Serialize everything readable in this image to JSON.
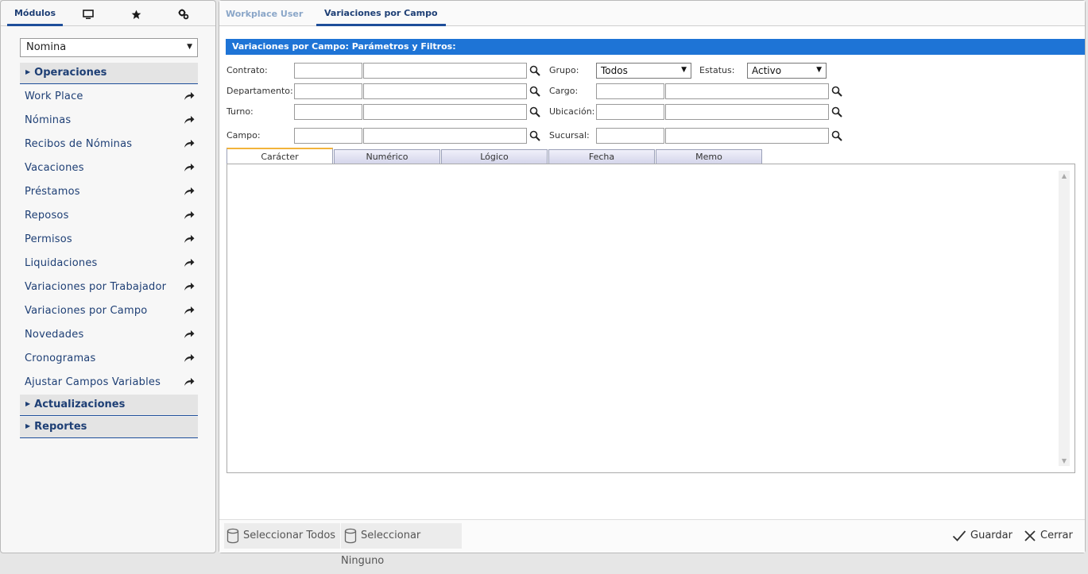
{
  "left_panel": {
    "tabs": {
      "modules": "Módulos"
    },
    "module_select": {
      "value": "Nomina"
    },
    "sections": {
      "operaciones": "Operaciones",
      "actualizaciones": "Actualizaciones",
      "reportes": "Reportes"
    },
    "items": [
      "Work Place",
      "Nóminas",
      "Recibos de Nóminas",
      "Vacaciones",
      "Préstamos",
      "Reposos",
      "Permisos",
      "Liquidaciones",
      "Variaciones por Trabajador",
      "Variaciones por Campo",
      "Novedades",
      "Cronogramas",
      "Ajustar Campos Variables"
    ]
  },
  "main_tabs": {
    "workplace": "Workplace User",
    "active": "Variaciones por Campo"
  },
  "filter_bar": {
    "title": "Variaciones por Campo: Parámetros y Filtros:"
  },
  "filters": {
    "contrato": "Contrato:",
    "departamento": "Departamento:",
    "turno": "Turno:",
    "campo": "Campo:",
    "grupo": "Grupo:",
    "grupo_value": "Todos",
    "estatus": "Estatus:",
    "estatus_value": "Activo",
    "cargo": "Cargo:",
    "ubicacion": "Ubicación:",
    "sucursal": "Sucursal:"
  },
  "sub_tabs": [
    "Carácter",
    "Numérico",
    "Lógico",
    "Fecha",
    "Memo"
  ],
  "footer": {
    "select_all": "Seleccionar Todos",
    "select_none": "Seleccionar Ninguno",
    "save": "Guardar",
    "close": "Cerrar"
  },
  "colors": {
    "accent": "#1e74d6",
    "nav_text": "#1e3f75",
    "tab_underline": "#1e4e9a",
    "active_subtab_top": "#f2b33a"
  }
}
